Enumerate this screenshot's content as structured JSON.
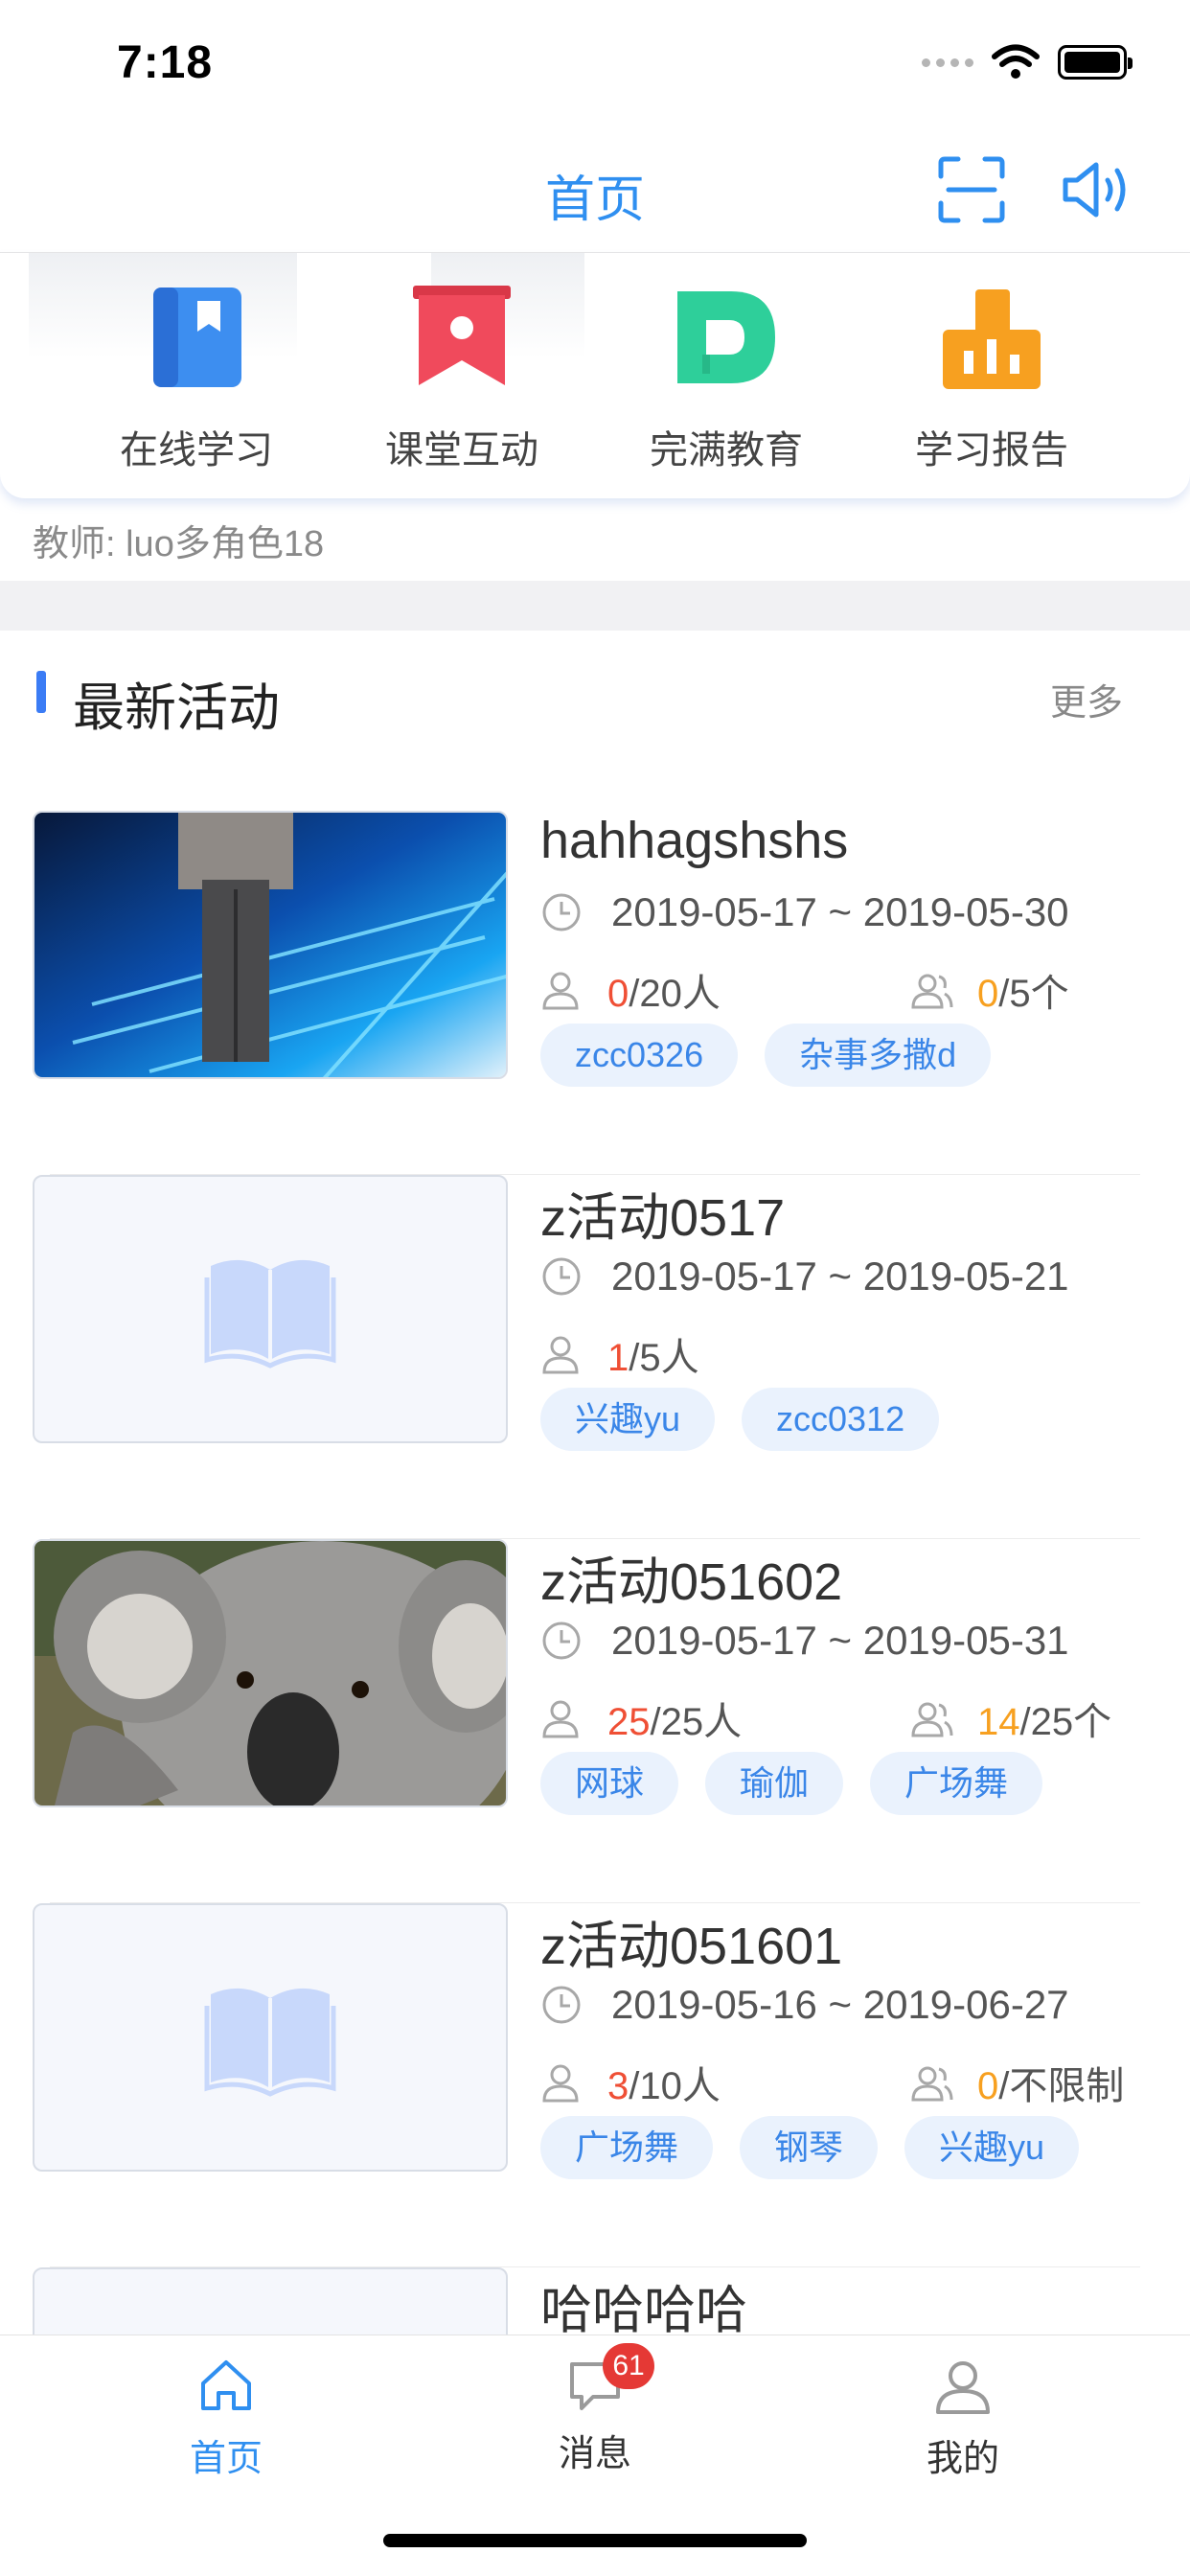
{
  "status_bar": {
    "time": "7:18"
  },
  "nav": {
    "title": "首页",
    "scan_icon": "scan-icon",
    "voice_icon": "speaker-icon"
  },
  "quick_menu": [
    {
      "label": "在线学习",
      "icon": "book-bookmark-icon",
      "color": "#3d8ef0"
    },
    {
      "label": "课堂互动",
      "icon": "banner-icon",
      "color": "#f04a5c"
    },
    {
      "label": "完满教育",
      "icon": "letter-d-icon",
      "color": "#2ecf9a"
    },
    {
      "label": "学习报告",
      "icon": "bar-chart-icon",
      "color": "#f7a020"
    }
  ],
  "teacher": "教师: luo多角色18",
  "section": {
    "title": "最新活动",
    "more": "更多"
  },
  "activities": [
    {
      "title": "hahhagshshs",
      "date": "2019-05-17 ~ 2019-05-30",
      "people_count": "0",
      "people_total": "/20人",
      "group_count": "0",
      "group_total": "/5个",
      "tags": [
        "zcc0326",
        "杂事多撒d"
      ],
      "image": "anime-space"
    },
    {
      "title": "z活动0517",
      "date": "2019-05-17 ~ 2019-05-21",
      "people_count": "1",
      "people_total": "/5人",
      "tags": [
        "兴趣yu",
        "zcc0312"
      ],
      "image": "placeholder"
    },
    {
      "title": "z活动051602",
      "date": "2019-05-17 ~ 2019-05-31",
      "people_count": "25",
      "people_total": "/25人",
      "group_count": "14",
      "group_total": "/25个",
      "tags": [
        "网球",
        "瑜伽",
        "广场舞"
      ],
      "image": "koala"
    },
    {
      "title": "z活动051601",
      "date": "2019-05-16 ~ 2019-06-27",
      "people_count": "3",
      "people_total": "/10人",
      "group_count": "0",
      "group_total": "/不限制",
      "tags": [
        "广场舞",
        "钢琴",
        "兴趣yu"
      ],
      "image": "placeholder"
    },
    {
      "title": "哈哈哈哈",
      "image": "placeholder"
    }
  ],
  "tab_bar": [
    {
      "label": "首页",
      "icon": "home-icon",
      "active": true
    },
    {
      "label": "消息",
      "icon": "message-icon",
      "badge": "61"
    },
    {
      "label": "我的",
      "icon": "user-icon"
    }
  ]
}
